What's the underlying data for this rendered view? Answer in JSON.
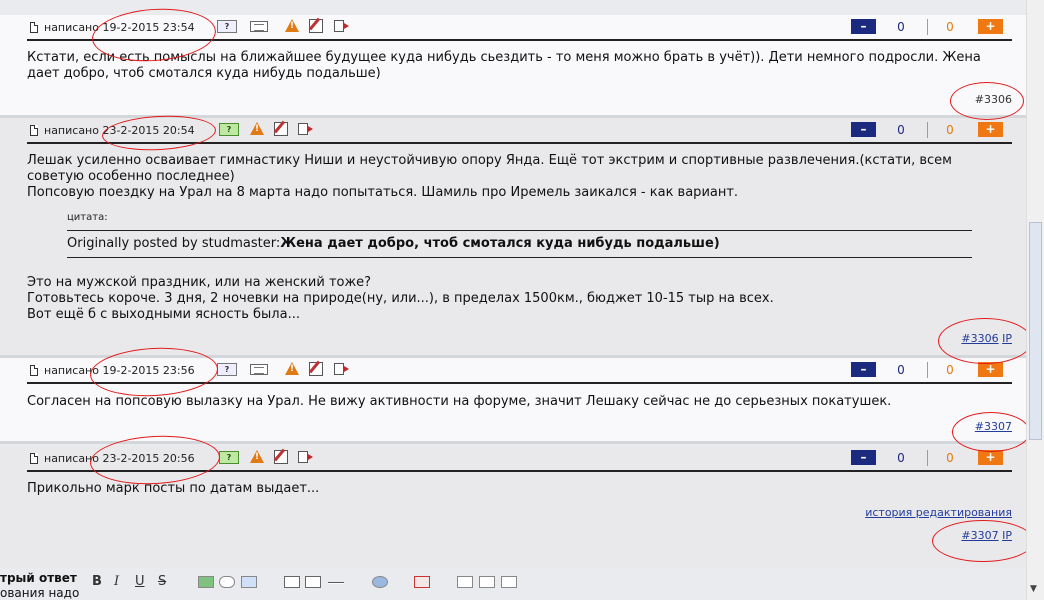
{
  "written_label": "написано",
  "posts": [
    {
      "date": "19-2-2015 23:54",
      "paragraphs": [
        "Кстати, если есть помыслы на ближайшее будущее куда нибудь сьездить - то меня можно брать в учёт)). Дети немного подросли. Жена",
        "дает добро, чтоб смотался куда нибудь подальше)"
      ],
      "permalink": "#3306",
      "rating": {
        "neg": "0",
        "pos": "0"
      }
    },
    {
      "date": "23-2-2015 20:54",
      "paragraphs": [
        "Лешак усиленно осваивает гимнастику Ниши и неустойчивую опору Янда. Ещё тот экстрим и спортивные развлечения.(кстати, всем",
        "советую особенно последнее)",
        "Попсовую поездку на Урал на 8 марта надо попытаться. Шамиль про Иремель заикался - как вариант."
      ],
      "quote": {
        "label": "цитата:",
        "prefix": "Originally posted by studmaster:",
        "text": "Жена дает добро, чтоб смотался куда нибудь подальше)"
      },
      "paragraphs_after": [
        "Это на мужской праздник, или на женский тоже?",
        "Готовьтесь короче. 3 дня, 2 ночевки на природе(ну, или...), в пределах 1500км., бюджет 10-15 тыр на всех.",
        "Вот ещё б с выходными ясность была..."
      ],
      "permalink": "#3306",
      "ip": "IP",
      "rating": {
        "neg": "0",
        "pos": "0"
      }
    },
    {
      "date": "19-2-2015 23:56",
      "paragraphs": [
        "Согласен на попсовую вылазку на Урал. Не вижу активности на форуме, значит Лешаку сейчас не до серьезных покатушек."
      ],
      "permalink": "#3307",
      "rating": {
        "neg": "0",
        "pos": "0"
      }
    },
    {
      "date": "23-2-2015 20:56",
      "paragraphs": [
        "Прикольно марк посты по датам выдает..."
      ],
      "edit_history": "история редактирования",
      "permalink": "#3307",
      "ip": "IP",
      "rating": {
        "neg": "0",
        "pos": "0"
      }
    }
  ],
  "rating_buttons": {
    "minus": "–",
    "plus": "+"
  },
  "icons": {
    "profile_tag": "?",
    "names": [
      "document-icon",
      "profile-icon",
      "pm-icon",
      "report-icon",
      "edit-icon",
      "quote-icon"
    ]
  },
  "quick_reply": {
    "title": "трый ответ",
    "subtitle": "ования надо"
  },
  "toolbar": {
    "bold": "B",
    "italic": "I",
    "underline": "U",
    "strike": "S"
  },
  "colors": {
    "minus": "#1b2a7e",
    "plus": "#f07812",
    "annotation": "#e21a1a",
    "link": "#223c9a"
  }
}
